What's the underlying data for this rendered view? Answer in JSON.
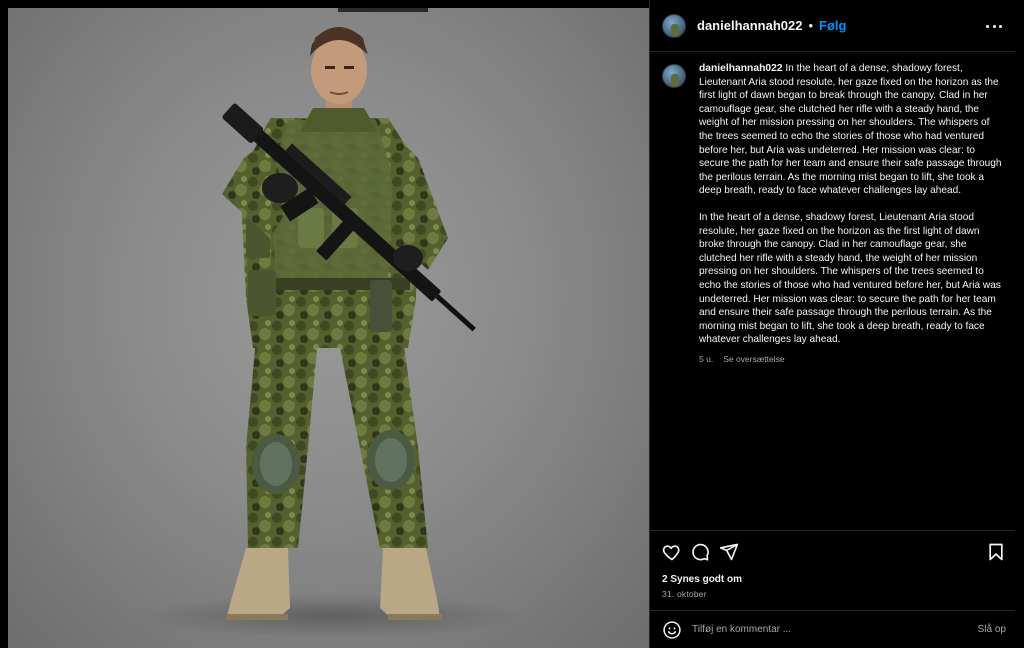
{
  "post": {
    "image_alt": "Illustration of a soldier in camouflage uniform holding a rifle",
    "author": {
      "username": "danielhannah022"
    },
    "follow_label": "Følg",
    "separator": "•",
    "caption_paragraph_1": "In the heart of a dense, shadowy forest, Lieutenant Aria stood resolute, her gaze fixed on the horizon as the first light of dawn began to break through the canopy. Clad in her camouflage gear, she clutched her rifle with a steady hand, the weight of her mission pressing on her shoulders. The whispers of the trees seemed to echo the stories of those who had ventured before her, but Aria was undeterred. Her mission was clear: to secure the path for her team and ensure their safe passage through the perilous terrain. As the morning mist began to lift, she took a deep breath, ready to face whatever challenges lay ahead.",
    "caption_paragraph_2": "In the heart of a dense, shadowy forest, Lieutenant Aria stood resolute, her gaze fixed on the horizon as the first light of dawn broke through the canopy. Clad in her camouflage gear, she clutched her rifle with a steady hand, the weight of her mission pressing on her shoulders. The whispers of the trees seemed to echo the stories of those who had ventured before her, but Aria was undeterred. Her mission was clear: to secure the path for her team and ensure their safe passage through the perilous terrain. As the morning mist began to lift, she took a deep breath, ready to face whatever challenges lay ahead.",
    "age": "5 u.",
    "translate_label": "Se oversættelse",
    "likes": "2 Synes godt om",
    "date": "31. oktober"
  },
  "actions": {
    "like_icon": "heart-icon",
    "comment_icon": "comment-icon",
    "share_icon": "paper-plane-icon",
    "save_icon": "bookmark-icon"
  },
  "comment_box": {
    "placeholder": "Tilføj en kommentar ...",
    "post_label": "Slå op"
  },
  "colors": {
    "background": "#000000",
    "link_blue": "#0095f6",
    "muted_text": "#a8a8a8",
    "divider": "#262626"
  }
}
